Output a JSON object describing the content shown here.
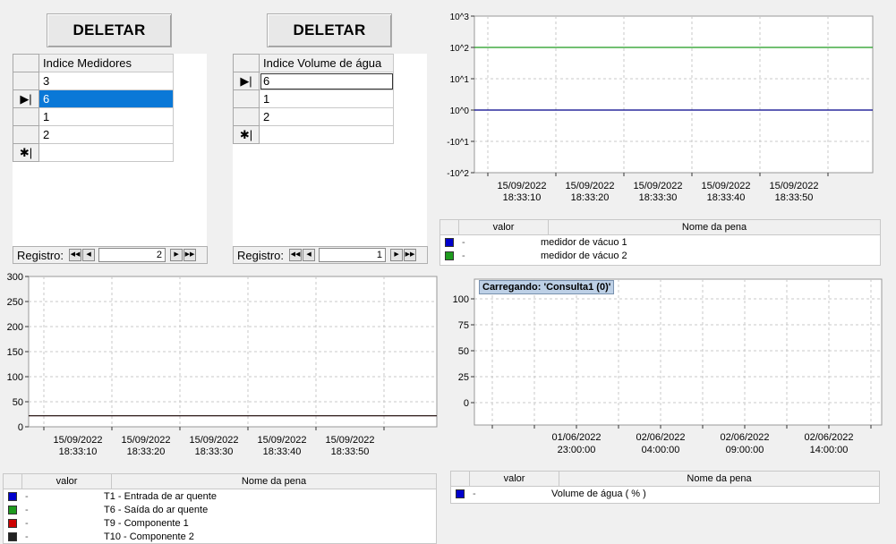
{
  "left_grid": {
    "button_label": "DELETAR",
    "header": "Indice Medidores",
    "rows": [
      "3",
      "6",
      "1",
      "2"
    ],
    "nav_label": "Registro:",
    "nav_value": "2"
  },
  "mid_grid": {
    "button_label": "DELETAR",
    "header": "Indice Volume de água",
    "rows": [
      "6",
      "1",
      "2"
    ],
    "nav_label": "Registro:",
    "nav_value": "1"
  },
  "chart_data": [
    {
      "type": "line",
      "y_scale": "log",
      "y_tick_labels": [
        "10^3",
        "10^2",
        "10^1",
        "10^0",
        "-10^1",
        "-10^2"
      ],
      "x_tick_labels": [
        [
          "15/09/2022",
          "18:33:10"
        ],
        [
          "15/09/2022",
          "18:33:20"
        ],
        [
          "15/09/2022",
          "18:33:30"
        ],
        [
          "15/09/2022",
          "18:33:40"
        ],
        [
          "15/09/2022",
          "18:33:50"
        ]
      ],
      "series": [
        {
          "name": "medidor de vácuo 1",
          "color": "#00008b",
          "value": "10^0"
        },
        {
          "name": "medidor de vácuo 2",
          "color": "#1e9b1e",
          "value": "10^2"
        }
      ],
      "grid": true
    },
    {
      "type": "line",
      "ylim": [
        0,
        300
      ],
      "y_ticks": [
        0,
        50,
        100,
        150,
        200,
        250,
        300
      ],
      "x_tick_labels": [
        [
          "15/09/2022",
          "18:33:10"
        ],
        [
          "15/09/2022",
          "18:33:20"
        ],
        [
          "15/09/2022",
          "18:33:30"
        ],
        [
          "15/09/2022",
          "18:33:40"
        ],
        [
          "15/09/2022",
          "18:33:50"
        ]
      ],
      "series": [
        {
          "name": "T1 -  Entrada de ar quente",
          "color": "#0000cc",
          "value": 22
        },
        {
          "name": "T6 - Saída do ar quente",
          "color": "#1e9b1e",
          "value": 22
        },
        {
          "name": "T9 - Componente 1",
          "color": "#cc0000",
          "value": 22
        },
        {
          "name": "T10 - Componente 2",
          "color": "#222222",
          "value": 22
        }
      ],
      "grid": true
    },
    {
      "type": "line",
      "y_ticks": [
        0,
        25,
        50,
        75,
        100
      ],
      "x_tick_labels": [
        [
          "01/06/2022",
          "23:00:00"
        ],
        [
          "02/06/2022",
          "04:00:00"
        ],
        [
          "02/06/2022",
          "09:00:00"
        ],
        [
          "02/06/2022",
          "14:00:00"
        ]
      ],
      "series": [
        {
          "name": "Volume de água ( % )",
          "color": "#0000cc"
        }
      ],
      "grid": true
    }
  ],
  "legend_top": {
    "col_value": "valor",
    "col_name": "Nome da pena",
    "dash": "-",
    "items": [
      "medidor de vácuo 1",
      "medidor de vácuo 2"
    ]
  },
  "legend_bottom_left": {
    "col_value": "valor",
    "col_name": "Nome da pena",
    "dash": "-",
    "items": [
      "T1 -  Entrada de ar quente",
      "T6 - Saída do ar quente",
      "T9 - Componente 1",
      "T10 - Componente 2"
    ]
  },
  "legend_bottom_right": {
    "col_value": "valor",
    "col_name": "Nome da pena",
    "dash": "-",
    "items": [
      "Volume de água ( % )"
    ]
  },
  "loading_text": "Carregando: 'Consulta1 (0)'"
}
